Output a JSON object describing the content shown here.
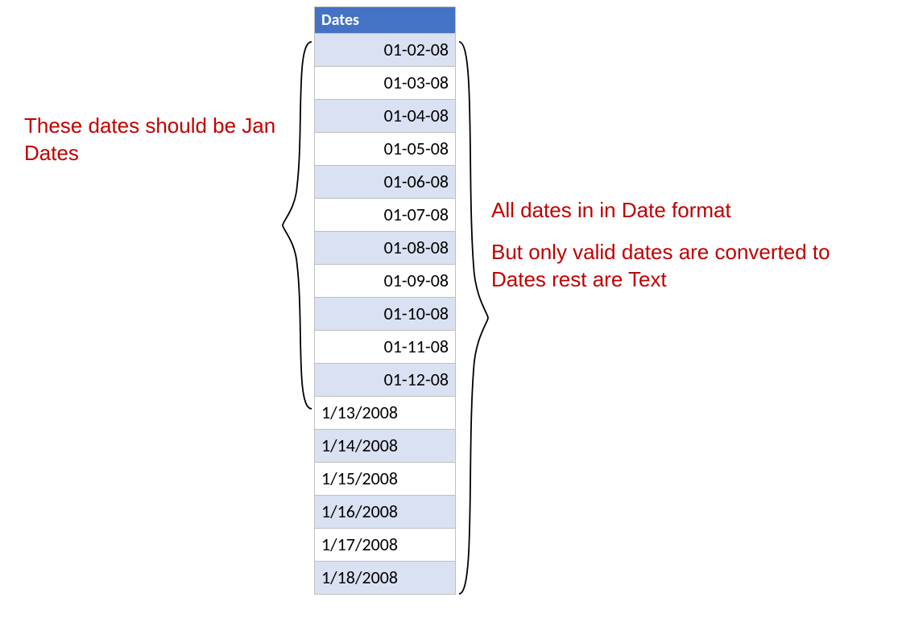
{
  "table": {
    "header": "Dates",
    "rows": [
      {
        "value": "01-02-08",
        "align": "right",
        "band": true
      },
      {
        "value": "01-03-08",
        "align": "right",
        "band": false
      },
      {
        "value": "01-04-08",
        "align": "right",
        "band": true
      },
      {
        "value": "01-05-08",
        "align": "right",
        "band": false
      },
      {
        "value": "01-06-08",
        "align": "right",
        "band": true
      },
      {
        "value": "01-07-08",
        "align": "right",
        "band": false
      },
      {
        "value": "01-08-08",
        "align": "right",
        "band": true
      },
      {
        "value": "01-09-08",
        "align": "right",
        "band": false
      },
      {
        "value": "01-10-08",
        "align": "right",
        "band": true
      },
      {
        "value": "01-11-08",
        "align": "right",
        "band": false
      },
      {
        "value": "01-12-08",
        "align": "right",
        "band": true
      },
      {
        "value": "1/13/2008",
        "align": "left",
        "band": false
      },
      {
        "value": "1/14/2008",
        "align": "left",
        "band": true
      },
      {
        "value": "1/15/2008",
        "align": "left",
        "band": false
      },
      {
        "value": "1/16/2008",
        "align": "left",
        "band": true
      },
      {
        "value": "1/17/2008",
        "align": "left",
        "band": false
      },
      {
        "value": "1/18/2008",
        "align": "left",
        "band": true
      }
    ]
  },
  "annotations": {
    "left": "These dates should be Jan Dates",
    "right_line1": "All dates in in Date format",
    "right_line2": "But only valid dates are converted to Dates rest are Text"
  }
}
